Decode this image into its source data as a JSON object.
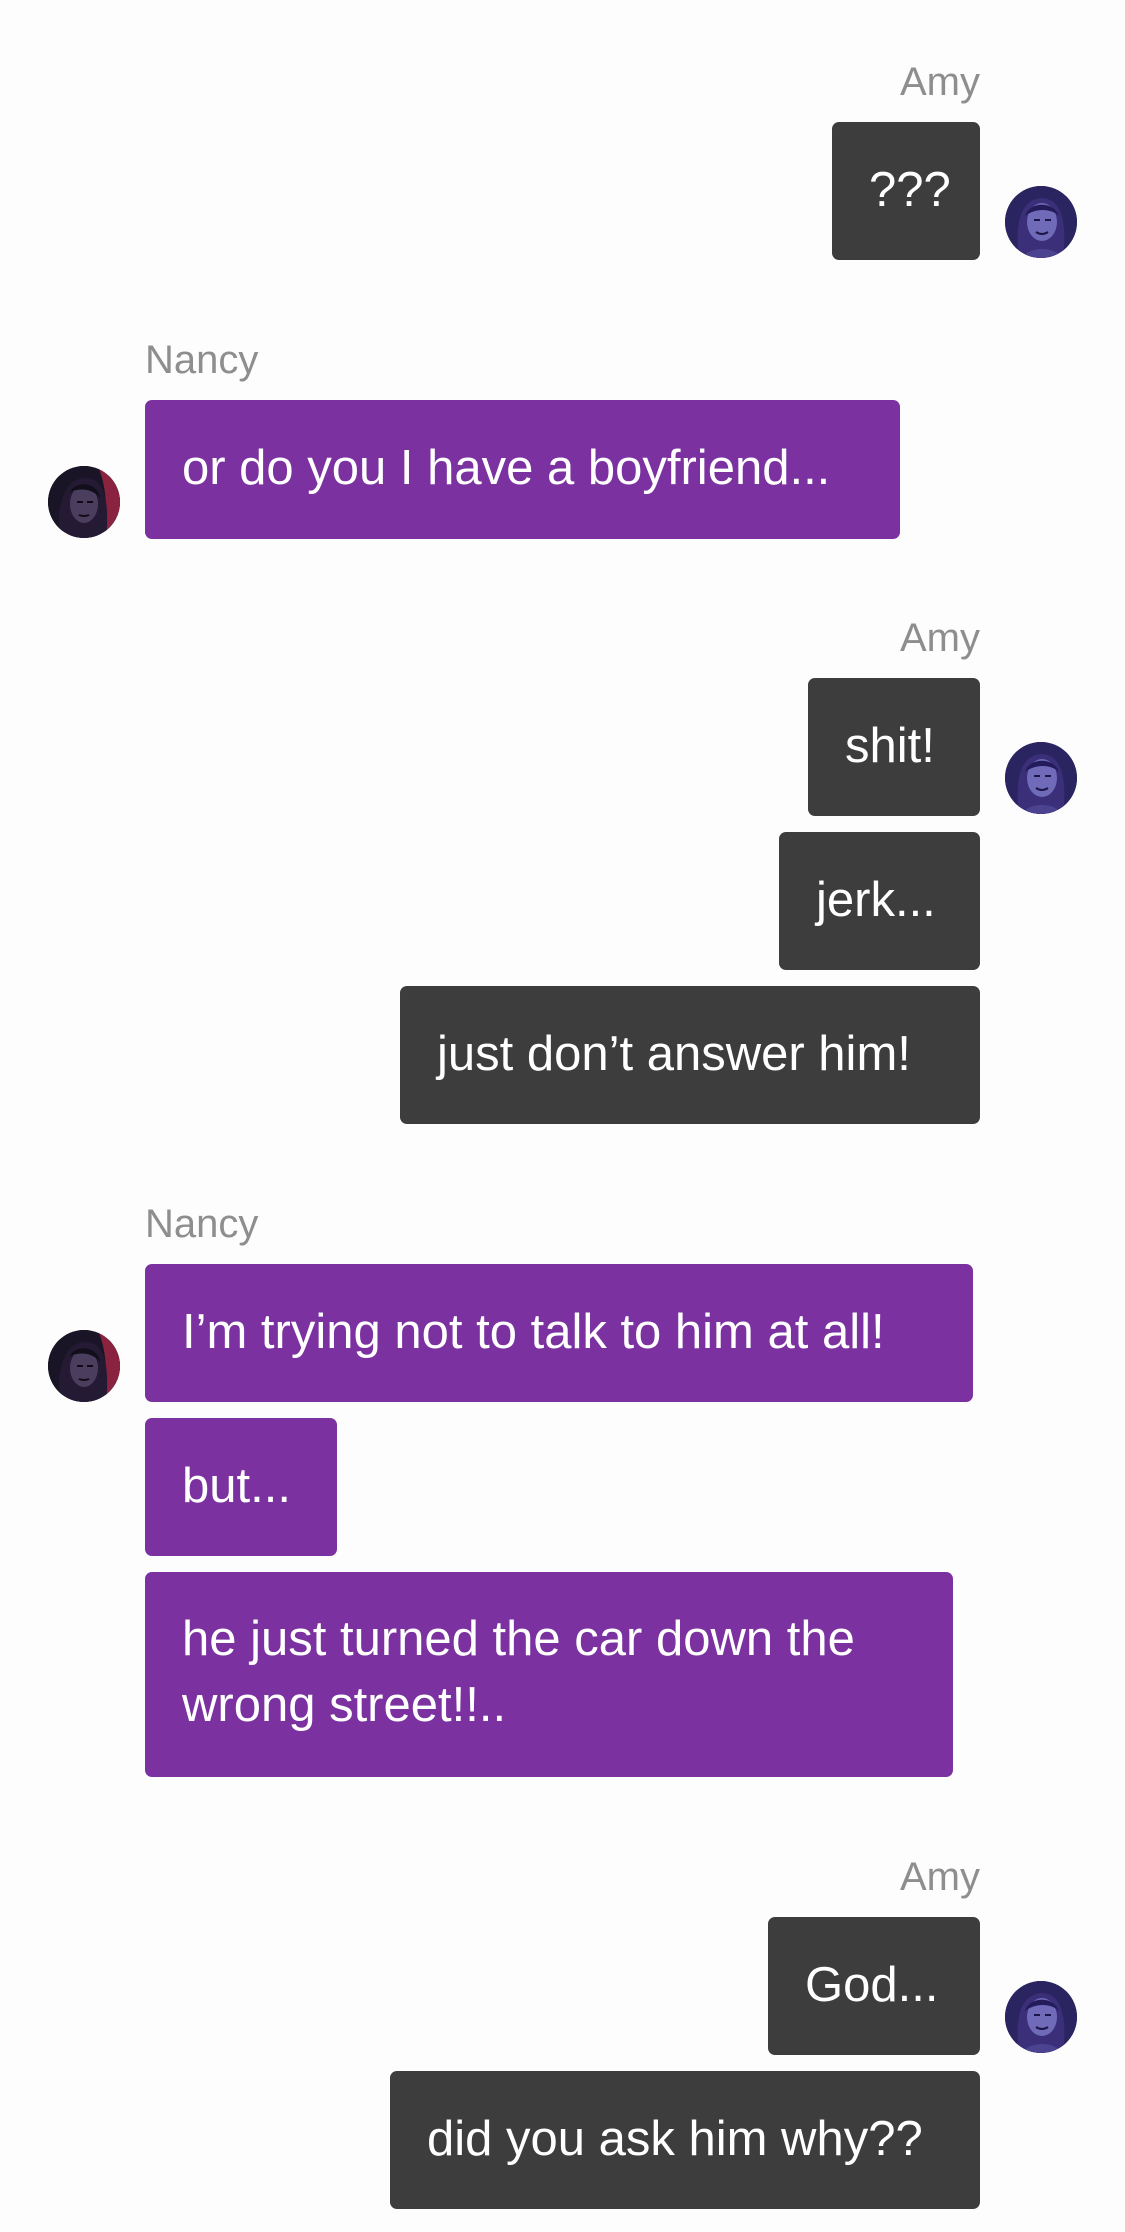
{
  "app": {
    "theme": {
      "me_bubble_color": "#3d3d3d",
      "them_bubble_color": "#7b31a0",
      "name_color": "#8e8e8e",
      "background": "#fdfdfd"
    }
  },
  "participants": {
    "me": {
      "name": "Amy",
      "avatar_icon": "amy-avatar-icon"
    },
    "them": {
      "name": "Nancy",
      "avatar_icon": "nancy-avatar-icon"
    }
  },
  "conversation": {
    "groups": [
      {
        "sender": "Amy",
        "messages": [
          "???"
        ]
      },
      {
        "sender": "Nancy",
        "messages": [
          "or do you I have a boyfriend..."
        ]
      },
      {
        "sender": "Amy",
        "messages": [
          "shit!",
          "jerk...",
          "just don’t answer him!"
        ]
      },
      {
        "sender": "Nancy",
        "messages": [
          "I’m trying not to talk to him at all!",
          "but...",
          "he just turned the car down the wrong street!!.."
        ]
      },
      {
        "sender": "Amy",
        "messages": [
          "God...",
          "did you ask him why??"
        ]
      }
    ]
  }
}
